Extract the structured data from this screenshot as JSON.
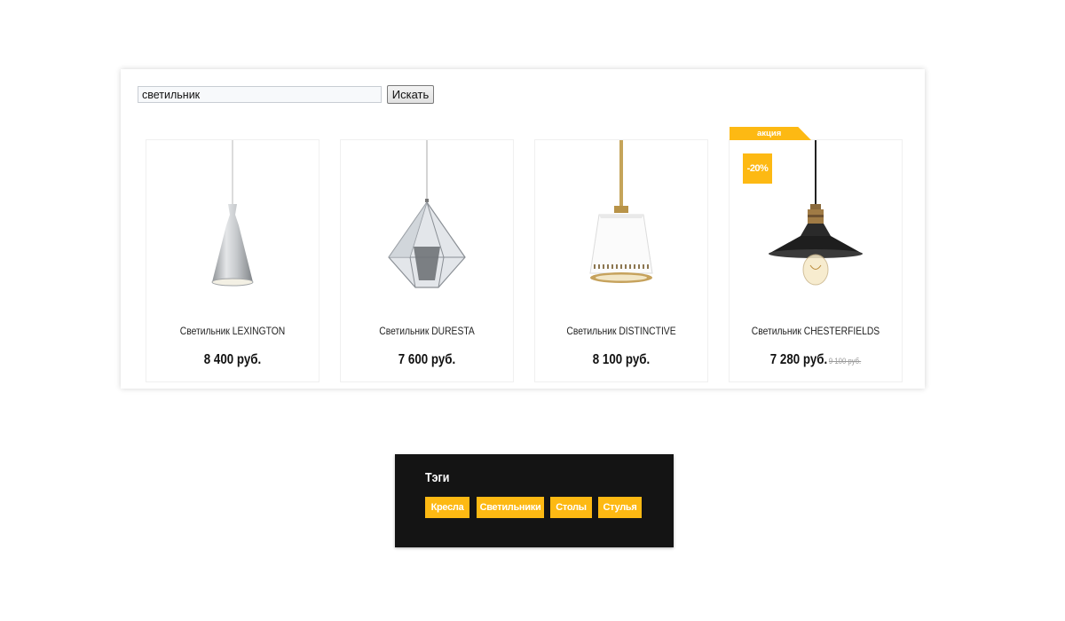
{
  "search": {
    "value": "светильник",
    "button_label": "Искать"
  },
  "products": [
    {
      "name": "Светильник LEXINGTON",
      "price": "8 400 руб.",
      "image_icon": "lamp-lexington-cone-icon"
    },
    {
      "name": "Светильник DURESTA",
      "price": "7 600 руб.",
      "image_icon": "lamp-duresta-prism-icon"
    },
    {
      "name": "Светильник DISTINCTIVE",
      "price": "8 100 руб.",
      "image_icon": "lamp-distinctive-white-icon"
    },
    {
      "name": "Светильник CHESTERFIELDS",
      "price": "7 280 руб.",
      "old_price": "9 100 руб.",
      "image_icon": "lamp-chesterfields-black-icon",
      "ribbon": "акция",
      "discount": "-20%"
    }
  ],
  "tags": {
    "title": "Тэги",
    "items": [
      "Кресла",
      "Светильники",
      "Столы",
      "Стулья"
    ]
  },
  "colors": {
    "accent": "#fdb913",
    "tags_background": "#141414",
    "old_price": "#9a9a9a"
  }
}
